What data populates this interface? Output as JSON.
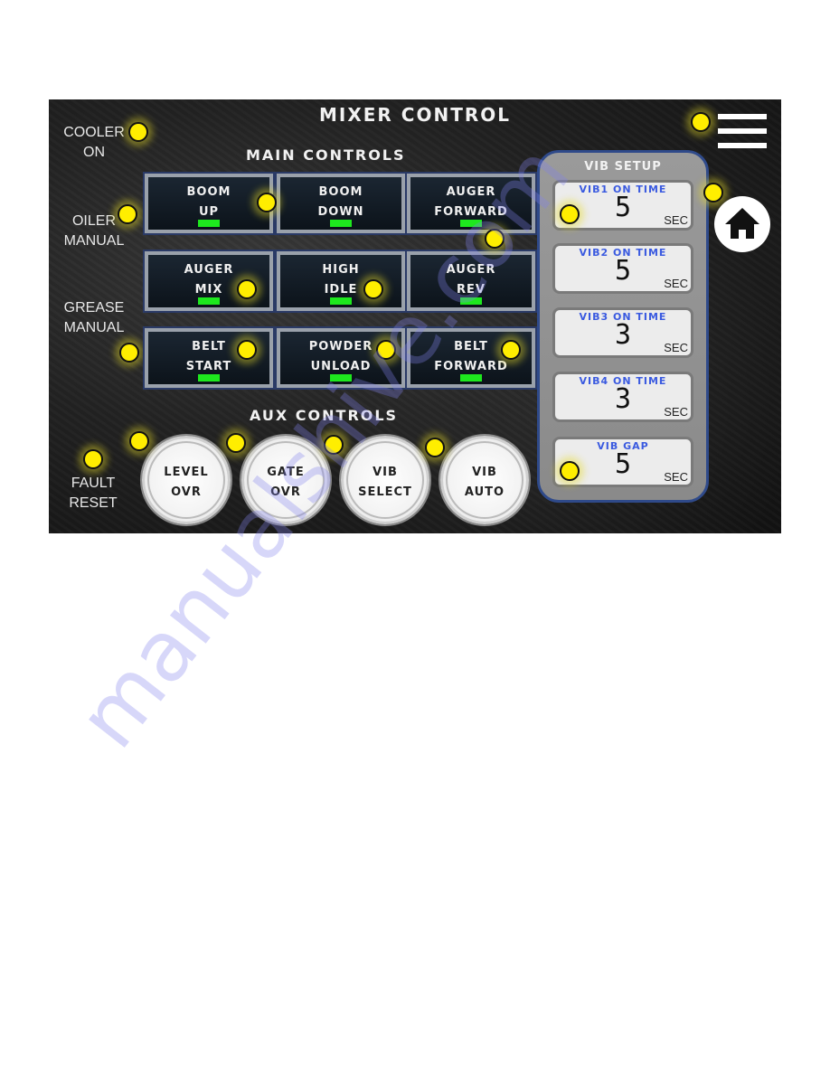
{
  "header": {
    "title": "MIXER CONTROL"
  },
  "indicators_left": [
    {
      "label_line1": "COOLER",
      "label_line2": "ON"
    },
    {
      "label_line1": "OILER",
      "label_line2": "MANUAL"
    },
    {
      "label_line1": "GREASE",
      "label_line2": "MANUAL"
    },
    {
      "label_line1": "FAULT",
      "label_line2": "RESET"
    }
  ],
  "main_controls": {
    "title": "MAIN CONTROLS",
    "buttons": [
      {
        "line1": "BOOM",
        "line2": "UP"
      },
      {
        "line1": "BOOM",
        "line2": "DOWN"
      },
      {
        "line1": "AUGER",
        "line2": "FORWARD"
      },
      {
        "line1": "AUGER",
        "line2": "MIX"
      },
      {
        "line1": "HIGH",
        "line2": "IDLE"
      },
      {
        "line1": "AUGER",
        "line2": "REV"
      },
      {
        "line1": "BELT",
        "line2": "START"
      },
      {
        "line1": "POWDER",
        "line2": "UNLOAD"
      },
      {
        "line1": "BELT",
        "line2": "FORWARD"
      }
    ],
    "indicator_color": "#1ee81e"
  },
  "aux_controls": {
    "title": "AUX CONTROLS",
    "buttons": [
      {
        "line1": "LEVEL",
        "line2": "OVR"
      },
      {
        "line1": "GATE",
        "line2": "OVR"
      },
      {
        "line1": "VIB",
        "line2": "SELECT"
      },
      {
        "line1": "VIB",
        "line2": "AUTO"
      }
    ]
  },
  "vib_setup": {
    "title": "VIB SETUP",
    "fields": [
      {
        "label": "VIB1 ON TIME",
        "value": "5",
        "unit": "SEC"
      },
      {
        "label": "VIB2 ON TIME",
        "value": "5",
        "unit": "SEC"
      },
      {
        "label": "VIB3 ON TIME",
        "value": "3",
        "unit": "SEC"
      },
      {
        "label": "VIB4 ON TIME",
        "value": "3",
        "unit": "SEC"
      },
      {
        "label": "VIB GAP",
        "value": "5",
        "unit": "SEC"
      }
    ]
  },
  "nav": {
    "menu_icon": "hamburger-menu-icon",
    "home_icon": "home-icon"
  },
  "callout_marker_color": "#ffee00",
  "watermark": "manualshive.com"
}
